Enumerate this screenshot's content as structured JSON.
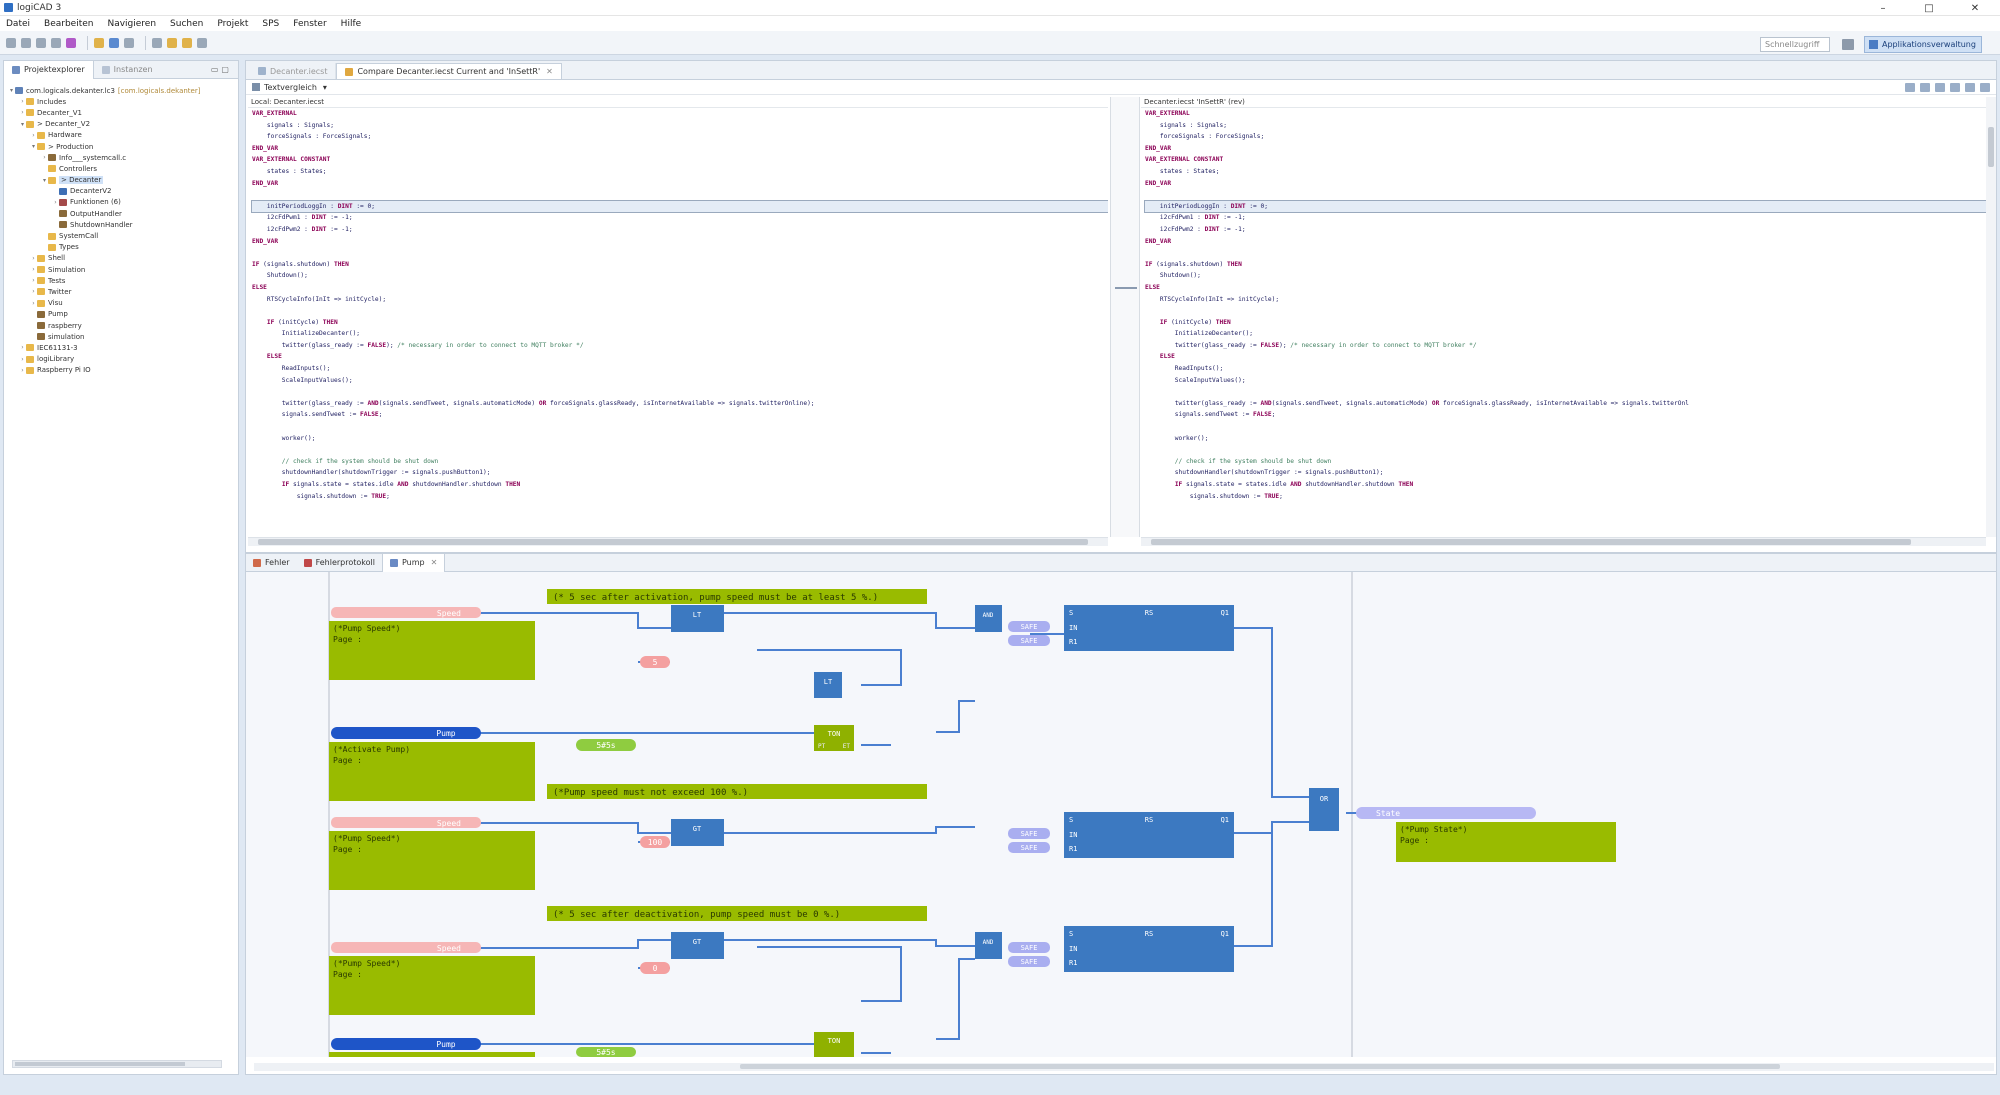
{
  "window": {
    "title": "logiCAD 3",
    "controls": [
      "–",
      "□",
      "✕"
    ]
  },
  "menu": [
    "Datei",
    "Bearbeiten",
    "Navigieren",
    "Suchen",
    "Projekt",
    "SPS",
    "Fenster",
    "Hilfe"
  ],
  "toolbar": {
    "quick_access_placeholder": "Schnellzugriff",
    "perspective_label": "Applikationsverwaltung"
  },
  "project_explorer": {
    "tabs": [
      "Projektexplorer",
      "Instanzen"
    ],
    "tree": [
      {
        "label": "com.logicals.dekanter.lc3",
        "suffix": "[com.logicals.dekanter]",
        "depth": 0,
        "toggle": "▾",
        "icon": "project-icon"
      },
      {
        "label": "Includes",
        "depth": 1,
        "toggle": "›",
        "icon": "folder-icon"
      },
      {
        "label": "Decanter_V1",
        "depth": 1,
        "toggle": "›",
        "icon": "folder-icon"
      },
      {
        "label": "> Decanter_V2",
        "depth": 1,
        "toggle": "▾",
        "icon": "folder-icon"
      },
      {
        "label": "Hardware",
        "depth": 2,
        "toggle": "›",
        "icon": "folder-icon"
      },
      {
        "label": "> Production",
        "depth": 2,
        "toggle": "▾",
        "icon": "folder-icon"
      },
      {
        "label": "Info___systemcall.c",
        "depth": 3,
        "toggle": "›",
        "icon": "file-icon"
      },
      {
        "label": "Controllers",
        "depth": 3,
        "toggle": "",
        "icon": "folder-icon"
      },
      {
        "label": "> Decanter",
        "depth": 3,
        "toggle": "▾",
        "icon": "folder-icon",
        "selected": true
      },
      {
        "label": "DecanterV2",
        "depth": 4,
        "toggle": "",
        "icon": "program-icon"
      },
      {
        "label": "Funktionen (6)",
        "depth": 4,
        "toggle": "›",
        "icon": "function-icon"
      },
      {
        "label": "OutputHandler",
        "depth": 4,
        "toggle": "",
        "icon": "block-icon"
      },
      {
        "label": "ShutdownHandler",
        "depth": 4,
        "toggle": "",
        "icon": "block-icon"
      },
      {
        "label": "SystemCall",
        "depth": 3,
        "toggle": "",
        "icon": "folder-icon"
      },
      {
        "label": "Types",
        "depth": 3,
        "toggle": "",
        "icon": "folder-icon"
      },
      {
        "label": "Shell",
        "depth": 2,
        "toggle": "›",
        "icon": "folder-icon"
      },
      {
        "label": "Simulation",
        "depth": 2,
        "toggle": "›",
        "icon": "folder-icon"
      },
      {
        "label": "Tests",
        "depth": 2,
        "toggle": "›",
        "icon": "folder-icon"
      },
      {
        "label": "Twitter",
        "depth": 2,
        "toggle": "›",
        "icon": "folder-icon"
      },
      {
        "label": "Visu",
        "depth": 2,
        "toggle": "›",
        "icon": "folder-icon"
      },
      {
        "label": "Pump",
        "depth": 2,
        "toggle": "",
        "icon": "block-icon"
      },
      {
        "label": "raspberry",
        "depth": 2,
        "toggle": "",
        "icon": "block-icon"
      },
      {
        "label": "simulation",
        "depth": 2,
        "toggle": "",
        "icon": "block-icon"
      },
      {
        "label": "IEC61131-3",
        "depth": 1,
        "toggle": "›",
        "icon": "folder-icon"
      },
      {
        "label": "logiLibrary",
        "depth": 1,
        "toggle": "›",
        "icon": "folder-icon"
      },
      {
        "label": "Raspberry Pi IO",
        "depth": 1,
        "toggle": "›",
        "icon": "folder-icon"
      }
    ]
  },
  "editor": {
    "tabs": [
      {
        "label": "Decanter.iecst",
        "active": false
      },
      {
        "label": "Compare Decanter.iecst Current and 'InSettR'",
        "active": true
      }
    ],
    "compare_mode": "Textvergleich",
    "left_header": "Local: Decanter.iecst",
    "right_header": "Decanter.iecst 'InSettR' (rev)",
    "left_code": [
      [
        [
          "kw",
          "VAR_EXTERNAL"
        ]
      ],
      [
        [
          "tx",
          "    signals : Signals;"
        ]
      ],
      [
        [
          "tx",
          "    forceSignals : ForceSignals;"
        ]
      ],
      [
        [
          "kw",
          "END_VAR"
        ]
      ],
      [
        [
          "kw",
          "VAR_EXTERNAL CONSTANT"
        ]
      ],
      [
        [
          "tx",
          "    states : States;"
        ]
      ],
      [
        [
          "kw",
          "END_VAR"
        ]
      ],
      [
        [
          "tx",
          ""
        ]
      ],
      [
        [
          "tx",
          "    initPeriodLoggIn : "
        ],
        [
          "kw",
          "DINT"
        ],
        [
          "tx",
          " := 0;"
        ]
      ],
      [
        [
          "tx",
          "    i2cFdPwm1 : "
        ],
        [
          "kw",
          "DINT"
        ],
        [
          "tx",
          " := -1;"
        ]
      ],
      [
        [
          "tx",
          "    i2cFdPwm2 : "
        ],
        [
          "kw",
          "DINT"
        ],
        [
          "tx",
          " := -1;"
        ]
      ],
      [
        [
          "kw",
          "END_VAR"
        ]
      ],
      [
        [
          "tx",
          ""
        ]
      ],
      [
        [
          "kw",
          "IF"
        ],
        [
          "tx",
          " (signals.shutdown) "
        ],
        [
          "kw",
          "THEN"
        ]
      ],
      [
        [
          "tx",
          "    Shutdown();"
        ]
      ],
      [
        [
          "kw",
          "ELSE"
        ]
      ],
      [
        [
          "tx",
          "    RTSCycleInfo(InIt => initCycle);"
        ]
      ],
      [
        [
          "tx",
          ""
        ]
      ],
      [
        [
          "tx",
          "    "
        ],
        [
          "kw",
          "IF"
        ],
        [
          "tx",
          " (initCycle) "
        ],
        [
          "kw",
          "THEN"
        ]
      ],
      [
        [
          "tx",
          "        InitializeDecanter();"
        ]
      ],
      [
        [
          "tx",
          "        twitter(glass_ready := "
        ],
        [
          "kw",
          "FALSE"
        ],
        [
          "tx",
          ");"
        ],
        [
          "cm",
          " /* necessary in order to connect to MQTT broker */"
        ]
      ],
      [
        [
          "tx",
          "    "
        ],
        [
          "kw",
          "ELSE"
        ]
      ],
      [
        [
          "tx",
          "        ReadInputs();"
        ]
      ],
      [
        [
          "tx",
          "        ScaleInputValues();"
        ]
      ],
      [
        [
          "tx",
          ""
        ]
      ],
      [
        [
          "tx",
          "        twitter(glass_ready := "
        ],
        [
          "kw",
          "AND"
        ],
        [
          "tx",
          "(signals.sendTweet, signals.automaticMode) "
        ],
        [
          "kw",
          "OR"
        ],
        [
          "tx",
          " forceSignals.glassReady, isInternetAvailable => signals.twitterOnline);"
        ]
      ],
      [
        [
          "tx",
          "        signals.sendTweet := "
        ],
        [
          "kw",
          "FALSE"
        ],
        [
          "tx",
          ";"
        ]
      ],
      [
        [
          "tx",
          ""
        ]
      ],
      [
        [
          "tx",
          "        worker();"
        ]
      ],
      [
        [
          "tx",
          ""
        ]
      ],
      [
        [
          "cm",
          "        // check if the system should be shut down"
        ]
      ],
      [
        [
          "tx",
          "        shutdownHandler(shutdownTrigger := signals.pushButton1);"
        ]
      ],
      [
        [
          "tx",
          "        "
        ],
        [
          "kw",
          "IF"
        ],
        [
          "tx",
          " signals.state = states.idle "
        ],
        [
          "kw",
          "AND"
        ],
        [
          "tx",
          " shutdownHandler.shutdown "
        ],
        [
          "kw",
          "THEN"
        ]
      ],
      [
        [
          "tx",
          "            signals.shutdown := "
        ],
        [
          "kw",
          "TRUE"
        ],
        [
          "tx",
          ";"
        ]
      ]
    ],
    "right_code": [
      [
        [
          "kw",
          "VAR_EXTERNAL"
        ]
      ],
      [
        [
          "tx",
          "    signals : Signals;"
        ]
      ],
      [
        [
          "tx",
          "    forceSignals : ForceSignals;"
        ]
      ],
      [
        [
          "kw",
          "END_VAR"
        ]
      ],
      [
        [
          "kw",
          "VAR_EXTERNAL CONSTANT"
        ]
      ],
      [
        [
          "tx",
          "    states : States;"
        ]
      ],
      [
        [
          "kw",
          "END_VAR"
        ]
      ],
      [
        [
          "tx",
          ""
        ]
      ],
      [
        [
          "tx",
          "    initPeriodLoggIn : "
        ],
        [
          "kw",
          "DINT"
        ],
        [
          "tx",
          " := 0;"
        ]
      ],
      [
        [
          "tx",
          "    i2cFdPwm1 : "
        ],
        [
          "kw",
          "DINT"
        ],
        [
          "tx",
          " := -1;"
        ]
      ],
      [
        [
          "tx",
          "    i2cFdPwm2 : "
        ],
        [
          "kw",
          "DINT"
        ],
        [
          "tx",
          " := -1;"
        ]
      ],
      [
        [
          "kw",
          "END_VAR"
        ]
      ],
      [
        [
          "tx",
          ""
        ]
      ],
      [
        [
          "kw",
          "IF"
        ],
        [
          "tx",
          " (signals.shutdown) "
        ],
        [
          "kw",
          "THEN"
        ]
      ],
      [
        [
          "tx",
          "    Shutdown();"
        ]
      ],
      [
        [
          "kw",
          "ELSE"
        ]
      ],
      [
        [
          "tx",
          "    RTSCycleInfo(InIt => initCycle);"
        ]
      ],
      [
        [
          "tx",
          ""
        ]
      ],
      [
        [
          "tx",
          "    "
        ],
        [
          "kw",
          "IF"
        ],
        [
          "tx",
          " (initCycle) "
        ],
        [
          "kw",
          "THEN"
        ]
      ],
      [
        [
          "tx",
          "        InitializeDecanter();"
        ]
      ],
      [
        [
          "tx",
          "        twitter(glass_ready := "
        ],
        [
          "kw",
          "FALSE"
        ],
        [
          "tx",
          ");"
        ],
        [
          "cm",
          " /* necessary in order to connect to MQTT broker */"
        ]
      ],
      [
        [
          "tx",
          "    "
        ],
        [
          "kw",
          "ELSE"
        ]
      ],
      [
        [
          "tx",
          "        ReadInputs();"
        ]
      ],
      [
        [
          "tx",
          "        ScaleInputValues();"
        ]
      ],
      [
        [
          "tx",
          ""
        ]
      ],
      [
        [
          "tx",
          "        twitter(glass_ready := "
        ],
        [
          "kw",
          "AND"
        ],
        [
          "tx",
          "(signals.sendTweet, signals.automaticMode) "
        ],
        [
          "kw",
          "OR"
        ],
        [
          "tx",
          " forceSignals.glassReady, isInternetAvailable => signals.twitterOnl"
        ]
      ],
      [
        [
          "tx",
          "        signals.sendTweet := "
        ],
        [
          "kw",
          "FALSE"
        ],
        [
          "tx",
          ";"
        ]
      ],
      [
        [
          "tx",
          ""
        ]
      ],
      [
        [
          "tx",
          "        worker();"
        ]
      ],
      [
        [
          "tx",
          ""
        ]
      ],
      [
        [
          "cm",
          "        // check if the system should be shut down"
        ]
      ],
      [
        [
          "tx",
          "        shutdownHandler(shutdownTrigger := signals.pushButton1);"
        ]
      ],
      [
        [
          "tx",
          "        "
        ],
        [
          "kw",
          "IF"
        ],
        [
          "tx",
          " signals.state = states.idle "
        ],
        [
          "kw",
          "AND"
        ],
        [
          "tx",
          " shutdownHandler.shutdown "
        ],
        [
          "kw",
          "THEN"
        ]
      ],
      [
        [
          "tx",
          "            signals.shutdown := "
        ],
        [
          "kw",
          "TRUE"
        ],
        [
          "tx",
          ";"
        ]
      ]
    ]
  },
  "bottom": {
    "tabs": [
      "Fehler",
      "Fehlerprotokoll",
      "Pump"
    ]
  },
  "diagram": {
    "comments": [
      "(* 5 sec after activation, pump speed must be at least 5 %.)",
      "(*Pump speed must not exceed 100 %.)",
      "(* 5 sec after deactivation, pump speed must be 0 %.)"
    ],
    "var_speed": "Speed",
    "var_pump": "Pump",
    "var_state": "State",
    "note_speed": "(*Pump Speed*)",
    "note_pump": "(*Activate Pump)",
    "note_state": "(*Pump State*)",
    "note_page": "Page :",
    "blocks": {
      "lt": "LT",
      "gt": "GT",
      "and": "AND",
      "or": "OR",
      "ton": "TON",
      "set_in": "S",
      "set_out": "Q1",
      "rs": "RS",
      "set_label": "S1",
      "in": "IN",
      "r1": "R1",
      "pt": "PT",
      "q": "Q",
      "et": "ET"
    },
    "constants": {
      "five": "5",
      "hundred": "100",
      "zero": "0",
      "five_s": "5#5s"
    },
    "set_inputs": [
      "SAFE",
      "SAFE"
    ]
  }
}
